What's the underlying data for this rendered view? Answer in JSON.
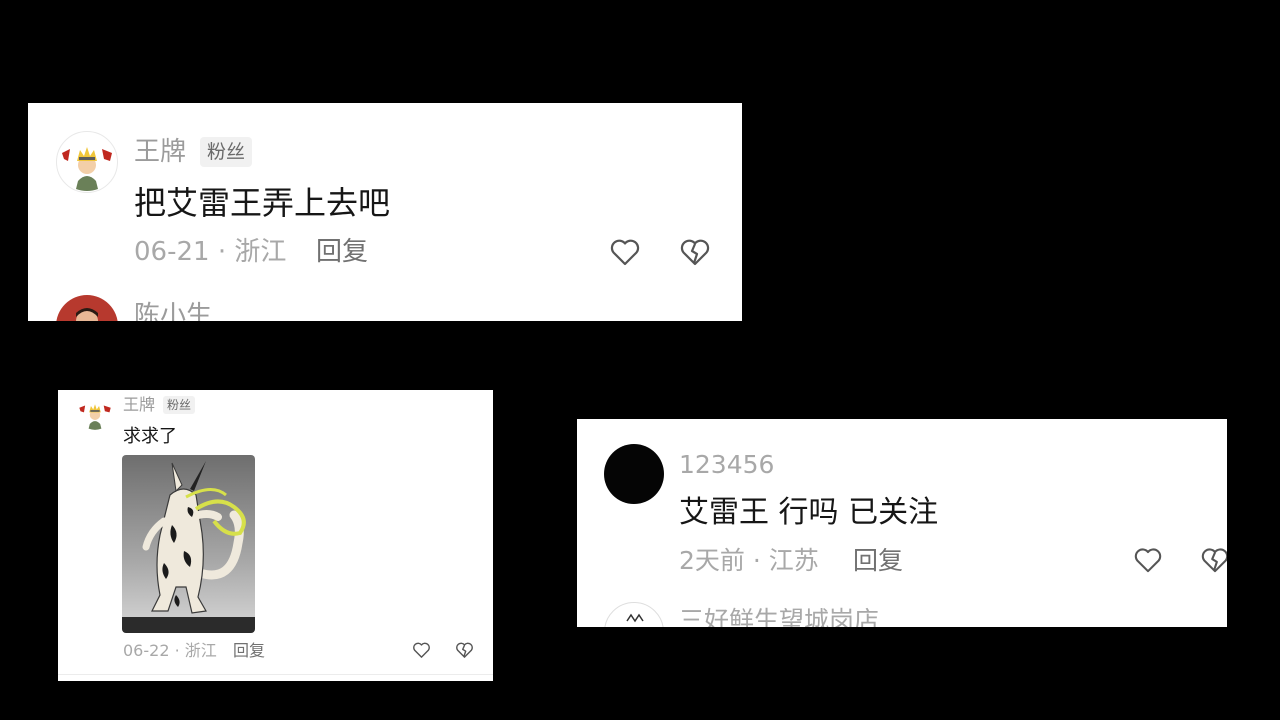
{
  "colors": {
    "background": "#000000",
    "card": "#ffffff",
    "username": "#9b9b9b",
    "comment": "#161616",
    "meta": "#a8a8a8",
    "reply": "#717171",
    "badge_bg": "#f1f1f1"
  },
  "card1": {
    "username": "王牌",
    "badge": "粉丝",
    "avatar_icon": "naruto-avatar-icon",
    "text": "把艾雷王弄上去吧",
    "meta": "06-21 · 浙江",
    "reply": "回复",
    "next_username": "陈小生"
  },
  "card2": {
    "username": "王牌",
    "badge": "粉丝",
    "avatar_icon": "naruto-avatar-icon",
    "text": "求求了",
    "image_icon": "monster-figure-image",
    "meta": "06-22 · 浙江",
    "reply": "回复"
  },
  "card3": {
    "username": "123456",
    "avatar_icon": "black-circle-avatar",
    "text": "艾雷王 行吗 已关注",
    "meta": "2天前 · 江苏",
    "reply": "回复",
    "next_username": "三好鲜生望城岗店"
  }
}
